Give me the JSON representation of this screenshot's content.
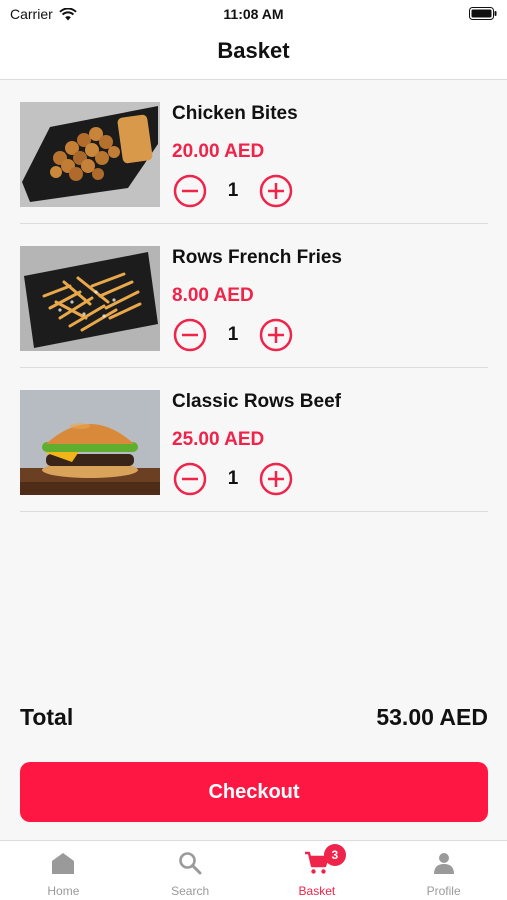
{
  "status_bar": {
    "carrier": "Carrier",
    "time": "11:08 AM"
  },
  "header": {
    "title": "Basket"
  },
  "items": [
    {
      "name": "Chicken Bites",
      "price": "20.00 AED",
      "quantity": "1"
    },
    {
      "name": "Rows French Fries",
      "price": "8.00 AED",
      "quantity": "1"
    },
    {
      "name": "Classic Rows Beef",
      "price": "25.00 AED",
      "quantity": "1"
    }
  ],
  "summary": {
    "total_label": "Total",
    "total_value": "53.00 AED"
  },
  "checkout": {
    "label": "Checkout"
  },
  "tab_bar": {
    "tabs": [
      {
        "label": "Home",
        "icon": "home-icon"
      },
      {
        "label": "Search",
        "icon": "search-icon"
      },
      {
        "label": "Basket",
        "icon": "cart-icon",
        "badge": "3"
      },
      {
        "label": "Profile",
        "icon": "person-icon"
      }
    ],
    "active_tab": "Basket"
  },
  "colors": {
    "accent": "#f0234a",
    "checkout": "#ff1744",
    "inactive": "#9a9a9a"
  }
}
